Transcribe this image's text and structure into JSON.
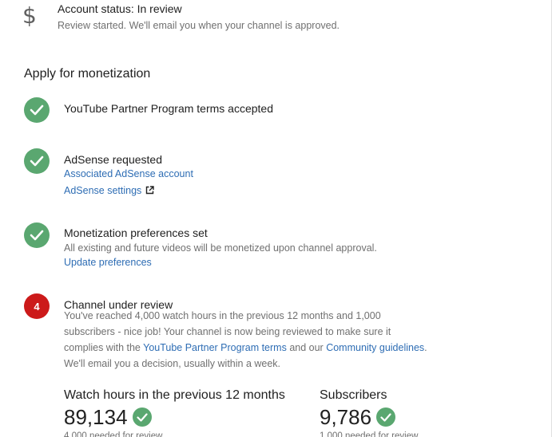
{
  "account_status": {
    "icon": "dollar-icon",
    "title": "Account status: In review",
    "subtitle": "Review started. We'll email you when your channel is approved."
  },
  "section": {
    "title": "Apply for monetization"
  },
  "steps": [
    {
      "badge": "check-icon",
      "title": "YouTube Partner Program terms accepted"
    },
    {
      "badge": "check-icon",
      "title": "AdSense requested",
      "links": [
        "Associated AdSense account",
        "AdSense settings"
      ],
      "external_icon": "external-link-icon"
    },
    {
      "badge": "check-icon",
      "title": "Monetization preferences set",
      "text": "All existing and future videos will be monetized upon channel approval.",
      "link": "Update preferences"
    },
    {
      "badge_number": "4",
      "title": "Channel under review",
      "lines": [
        "You've reached 4,000 watch hours in the previous 12 months and 1,000",
        "subscribers - nice job! Your channel is now being reviewed to make sure it"
      ],
      "line3_before": "complies with the ",
      "line3_link1": "YouTube Partner Program terms",
      "line3_middle": " and our ",
      "line3_link2": "Community guidelines",
      "line3_after": ".",
      "line4": "We'll email you a decision, usually within a week."
    }
  ],
  "metrics": [
    {
      "label": "Watch hours in the previous 12 months",
      "value": "89,134",
      "note": "4,000 needed for review"
    },
    {
      "label": "Subscribers",
      "value": "9,786",
      "note": "1,000 needed for review"
    }
  ],
  "colors": {
    "success_green": "#5aa770",
    "review_red": "#cc1a1a",
    "link_blue": "#2e6db4"
  }
}
